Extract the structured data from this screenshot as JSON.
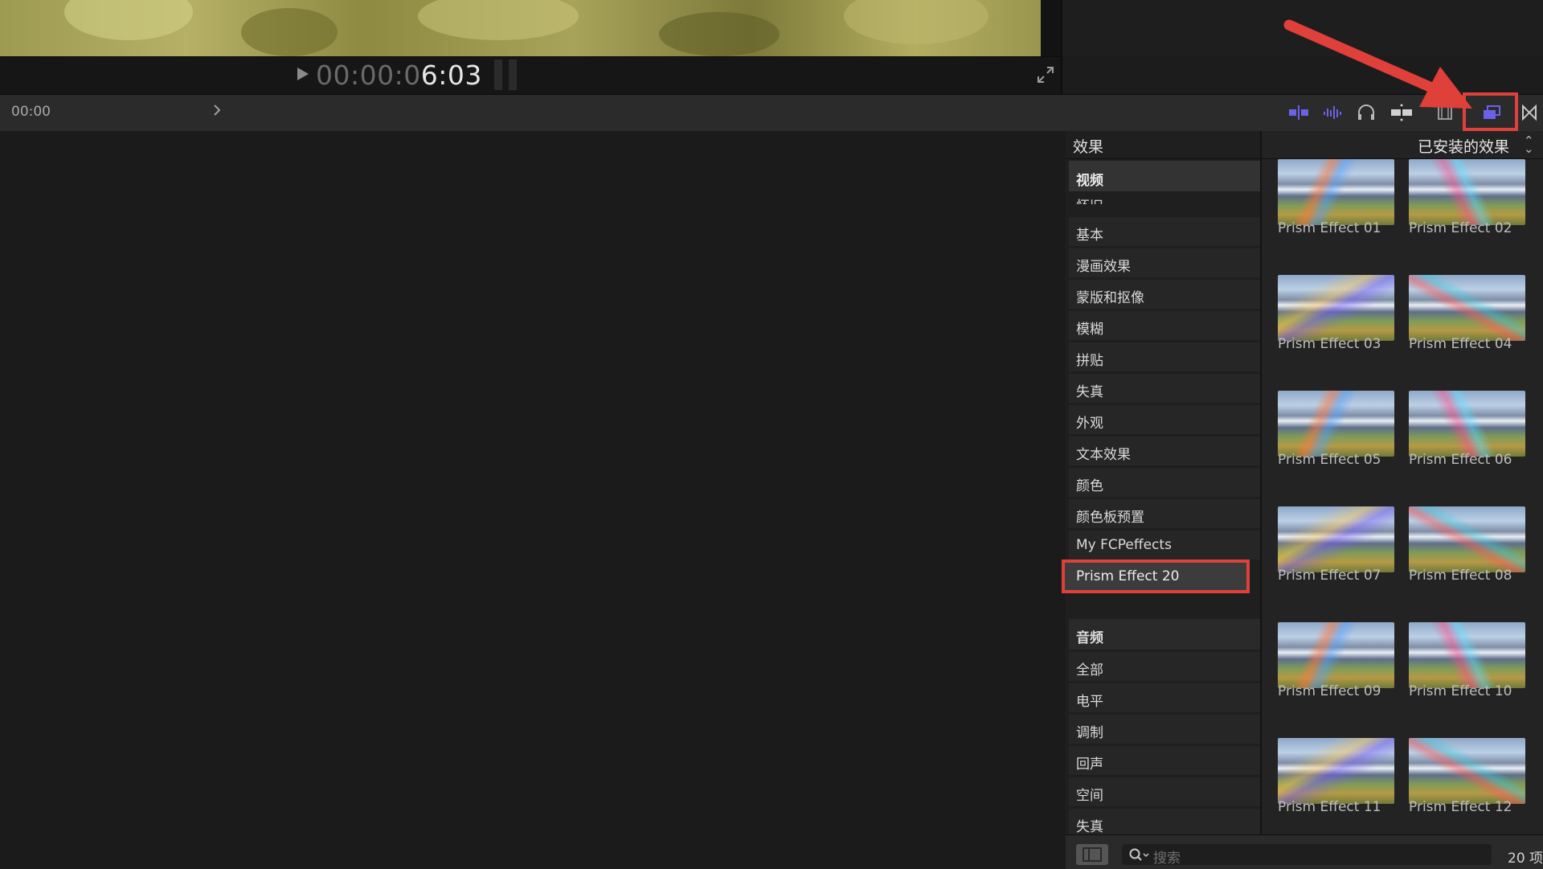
{
  "viewer": {
    "timecode_dim": "00:00:0",
    "timecode_lit": "6:03"
  },
  "toolbar": {
    "timeline_time": "00:00"
  },
  "effects": {
    "title": "效果",
    "installed_select": "已安装的效果",
    "video_header": "视频",
    "cut_item": "怀旧",
    "video_categories": [
      "基本",
      "漫画效果",
      "蒙版和抠像",
      "模糊",
      "拼贴",
      "失真",
      "外观",
      "文本效果",
      "颜色",
      "颜色板预置",
      "My FCPeffects"
    ],
    "selected_category": "Prism Effect 20",
    "audio_header": "音频",
    "audio_categories": [
      "全部",
      "电平",
      "调制",
      "回声",
      "空间",
      "失真"
    ],
    "thumbnails": [
      "Prism Effect 01",
      "Prism Effect 02",
      "Prism Effect 03",
      "Prism Effect 04",
      "Prism Effect 05",
      "Prism Effect 06",
      "Prism Effect 07",
      "Prism Effect 08",
      "Prism Effect 09",
      "Prism Effect 10",
      "Prism Effect 11",
      "Prism Effect 12"
    ]
  },
  "bottom": {
    "search_placeholder": "搜索",
    "item_count": "20 项"
  },
  "colors": {
    "accent_purple": "#6b62e8",
    "highlight_red": "#e0403a"
  }
}
